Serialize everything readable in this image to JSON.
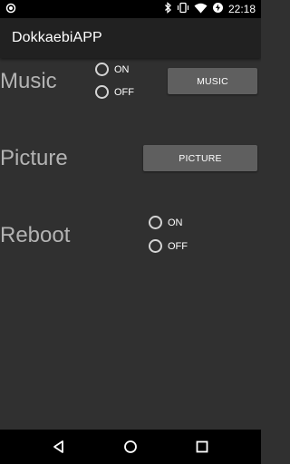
{
  "status_bar": {
    "time": "22:18",
    "icons": [
      "notification-ring-icon",
      "bluetooth-icon",
      "vibrate-icon",
      "wifi-icon",
      "battery-charging-icon"
    ]
  },
  "app_bar": {
    "title": "DokkaebiAPP"
  },
  "music": {
    "label": "Music",
    "option_on": "ON",
    "option_off": "OFF",
    "button_label": "MUSIC"
  },
  "picture": {
    "label": "Picture",
    "button_label": "PICTURE"
  },
  "reboot": {
    "label": "Reboot",
    "option_on": "ON",
    "option_off": "OFF"
  },
  "nav_bar": {
    "icons": [
      "back-icon",
      "home-icon",
      "recents-icon"
    ]
  },
  "colors": {
    "background": "#303030",
    "app_bar": "#212121",
    "button": "#5f5f5f",
    "label_text": "#b3b3b3"
  }
}
